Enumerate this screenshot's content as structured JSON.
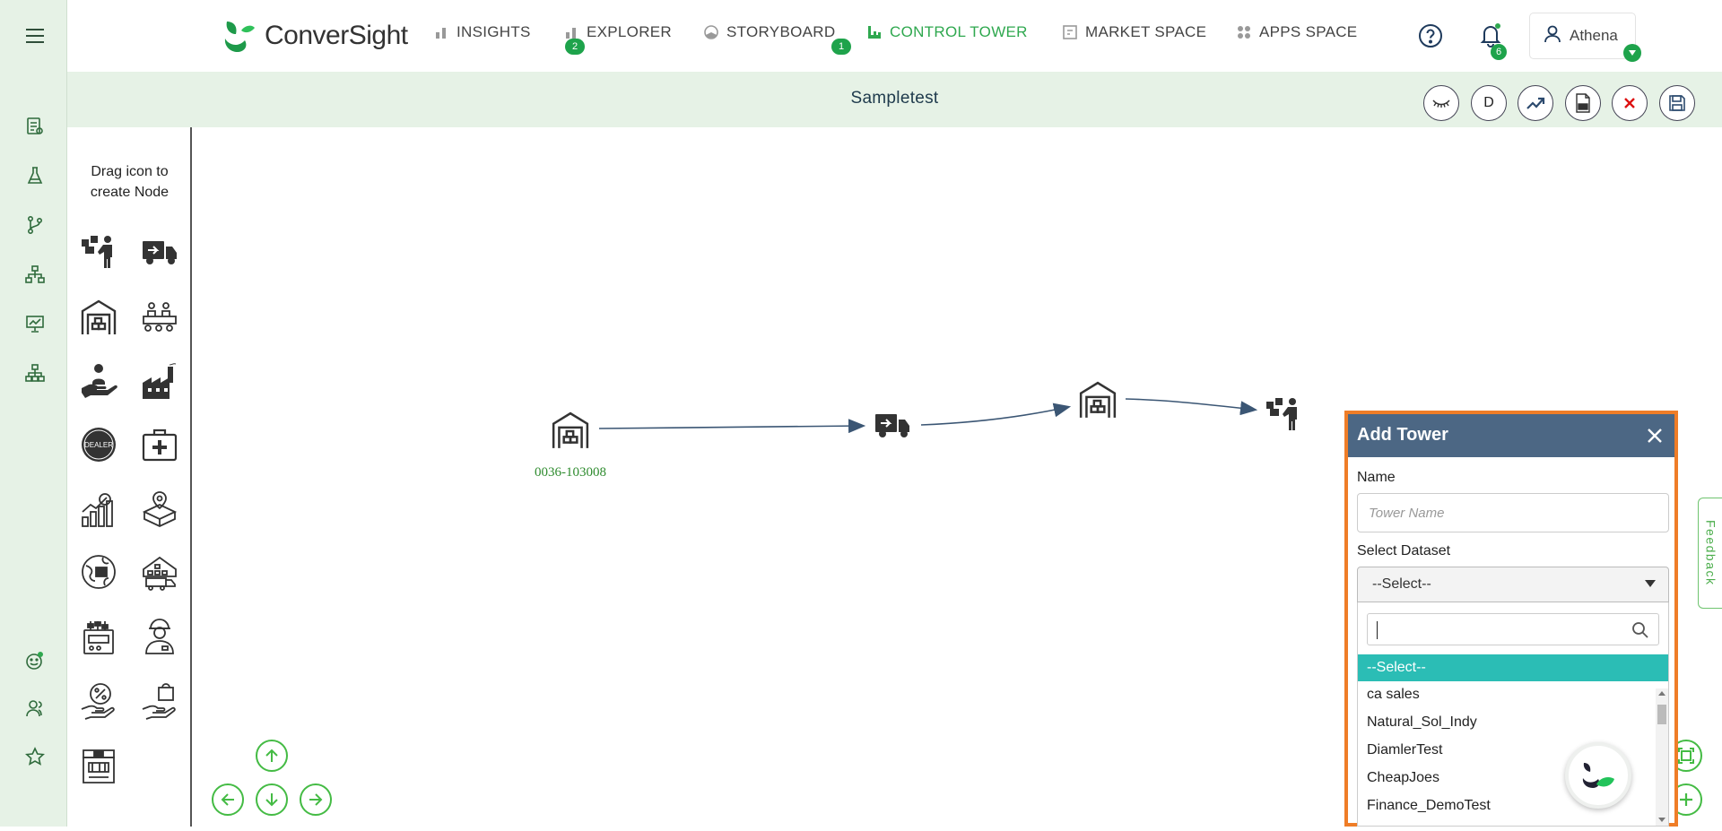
{
  "app": {
    "brand": "ConverSight",
    "brand_color": "#2fa84f"
  },
  "nav": {
    "items": [
      {
        "label": "INSIGHTS",
        "badge": "2",
        "icon": "bar-chart-icon"
      },
      {
        "label": "EXPLORER",
        "icon": "bar-chart-icon"
      },
      {
        "label": "STORYBOARD",
        "badge": "1",
        "icon": "pie-icon"
      },
      {
        "label": "CONTROL TOWER",
        "icon": "tower-icon",
        "active": true
      },
      {
        "label": "MARKET SPACE",
        "icon": "market-icon"
      },
      {
        "label": "APPS SPACE",
        "icon": "apps-grid-icon"
      }
    ],
    "notifications_count": "6",
    "user": "Athena"
  },
  "toolbar": {
    "title": "Sampletest",
    "buttons": [
      "hide-icon",
      "D",
      "trend-icon",
      "pdf-icon",
      "close-icon",
      "save-icon"
    ],
    "d_label": "D"
  },
  "palette": {
    "hint": "Drag icon to create Node",
    "icons": [
      "worker-boxes-icon",
      "delivery-truck-icon",
      "warehouse-icon",
      "production-line-icon",
      "hand-care-icon",
      "factory-icon",
      "dealer-icon",
      "first-aid-kit-icon",
      "growth-chart-icon",
      "map-box-icon",
      "global-box-icon",
      "distribution-center-icon",
      "control-panel-icon",
      "engineer-icon",
      "discount-hand-icon",
      "shopping-hand-icon",
      "store-icon"
    ]
  },
  "canvas": {
    "nodes": [
      {
        "icon": "warehouse-icon",
        "label": "0036-103008"
      },
      {
        "icon": "delivery-truck-icon",
        "label": ""
      },
      {
        "icon": "warehouse-icon",
        "label": ""
      },
      {
        "icon": "worker-boxes-icon",
        "label": ""
      }
    ],
    "node_label_color": "#2e8b2e"
  },
  "modal": {
    "title": "Add Tower",
    "name_label": "Name",
    "name_placeholder": "Tower Name",
    "dataset_label": "Select Dataset",
    "dataset_selected": "--Select--",
    "options": [
      "--Select--",
      "ca sales",
      "Natural_Sol_Indy",
      "DiamlerTest",
      "CheapJoes",
      "Finance_DemoTest"
    ],
    "header_color": "#4c6784",
    "border_color": "#ef7d27",
    "highlight_color": "#2bbdb5"
  },
  "feedback_label": "Feedback"
}
